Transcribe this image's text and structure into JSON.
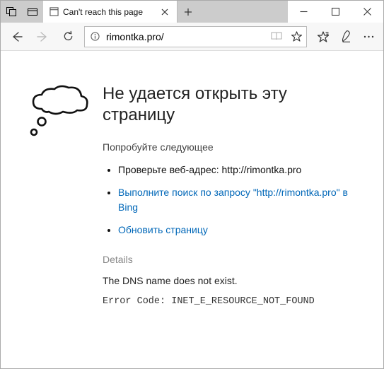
{
  "titlebar": {
    "tab_title": "Can't reach this page"
  },
  "toolbar": {
    "url": "rimontka.pro/"
  },
  "page": {
    "heading": "Не удается открыть эту страницу",
    "try_label": "Попробуйте следующее",
    "bullets": {
      "check_prefix": "Проверьте веб-адрес: ",
      "check_url": "http://rimontka.pro",
      "search": "Выполните поиск по запросу \"http://rimontka.pro\" в Bing",
      "refresh": "Обновить страницу"
    },
    "details_label": "Details",
    "dns_msg": "The DNS name does not exist.",
    "error_code_prefix": "Error Code: ",
    "error_code": "INET_E_RESOURCE_NOT_FOUND"
  }
}
